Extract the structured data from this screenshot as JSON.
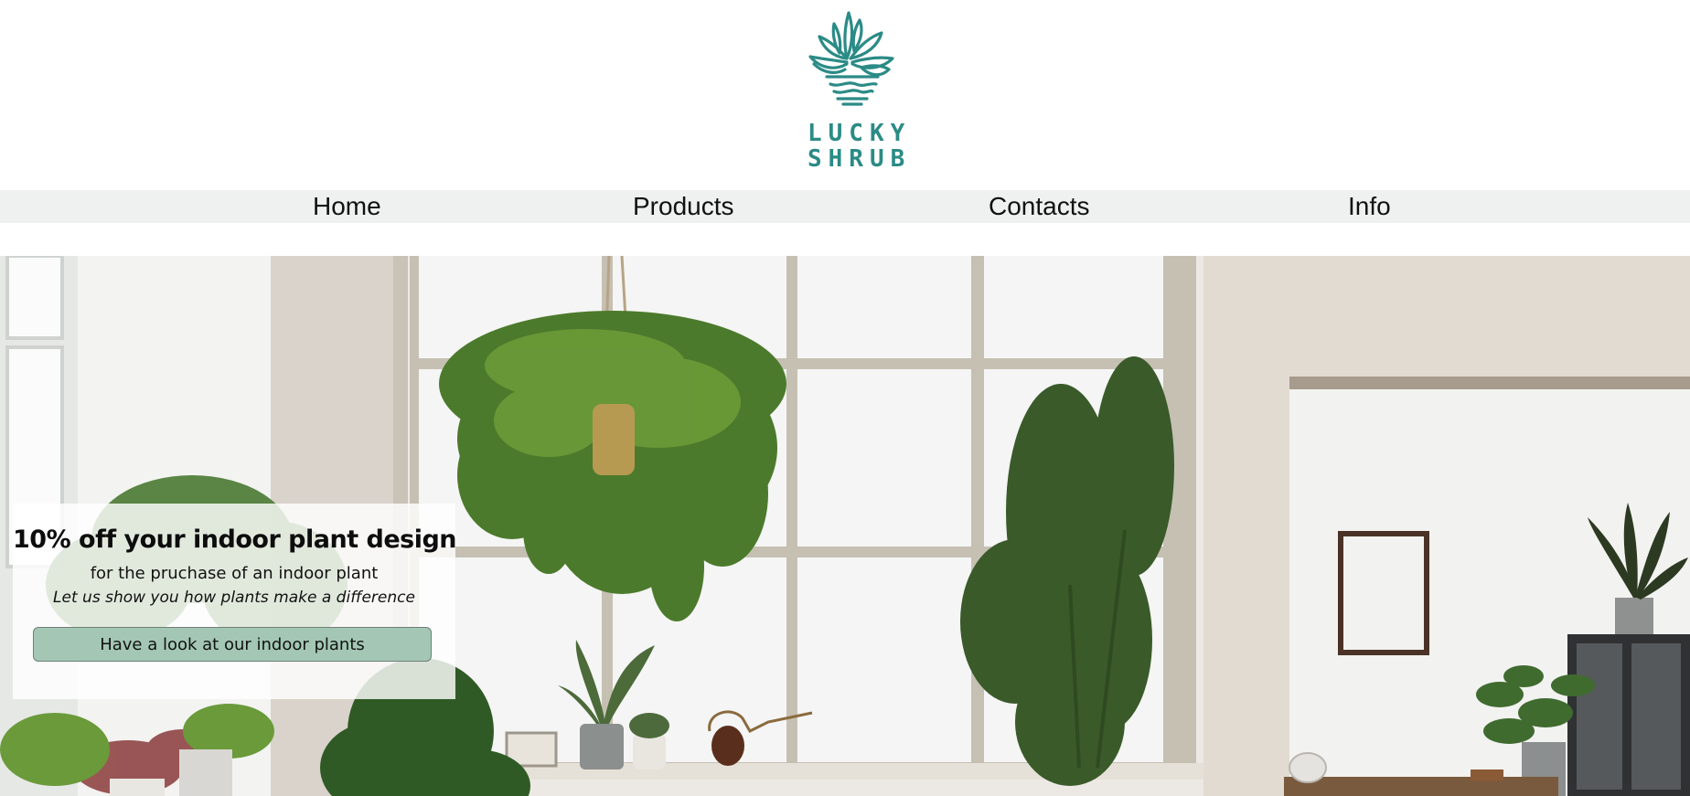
{
  "brand": {
    "logo_line1": "LUCKY",
    "logo_line2": "SHRUB",
    "logo_icon": "plant-pot-logo",
    "color": "#2b8b86"
  },
  "nav": {
    "items": [
      {
        "label": "Home"
      },
      {
        "label": "Products"
      },
      {
        "label": "Contacts"
      },
      {
        "label": "Info"
      }
    ],
    "background": "#eef1f0"
  },
  "promo": {
    "title": "10% off your indoor plant design",
    "subtitle": "for the pruchase of an indoor plant",
    "tagline": "Let us show you how plants make a difference",
    "button_label": "Have a look at our indoor plants",
    "button_color": "#a3c7b4"
  }
}
